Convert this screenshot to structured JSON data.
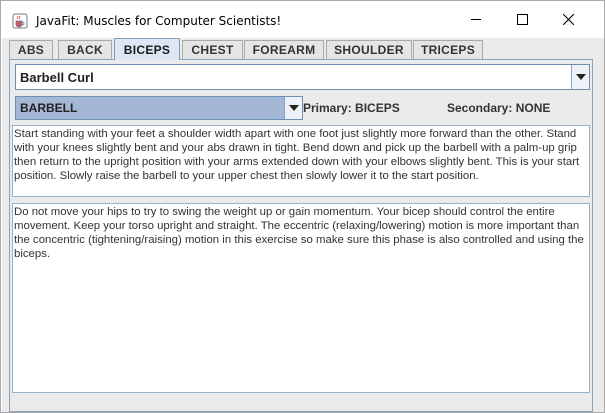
{
  "window": {
    "title": "JavaFit: Muscles for Computer Scientists!",
    "icon": "java-cup-icon",
    "controls": [
      "minimize-icon",
      "maximize-icon",
      "close-icon"
    ]
  },
  "tabs": [
    {
      "label": "ABS",
      "selected": false
    },
    {
      "label": "BACK",
      "selected": false
    },
    {
      "label": "BICEPS",
      "selected": true
    },
    {
      "label": "CHEST",
      "selected": false
    },
    {
      "label": "FOREARM",
      "selected": false
    },
    {
      "label": "SHOULDER",
      "selected": false
    },
    {
      "label": "TRICEPS",
      "selected": false
    }
  ],
  "exercise": {
    "selected": "Barbell Curl"
  },
  "equipment": {
    "selected": "BARBELL"
  },
  "muscles": {
    "primary": "Primary: BICEPS",
    "secondary": "Secondary: NONE"
  },
  "instructions": {
    "start_text": "Start standing with your feet a shoulder width apart with one foot just slightly more forward than the other. Stand with your knees slightly bent and your abs drawn in tight. Bend down and pick up the barbell with a palm-up grip then return to the upright position with your arms extended down with your elbows slightly bent. This is your start position.  Slowly raise the barbell to your upper chest then slowly lower it to the start position.",
    "notes_text": "Do not move your hips to try to swing the weight up or gain momentum. Your bicep should control the entire movement. Keep your torso upright and straight. The eccentric (relaxing/lowering) motion is more important than the concentric (tightening/raising) motion in this exercise so make sure this phase is also controlled and using the biceps."
  },
  "colors": {
    "selected_tab": "#dde7f4",
    "equipment_highlight": "#a4b8d6",
    "border": "#8aa3be"
  }
}
